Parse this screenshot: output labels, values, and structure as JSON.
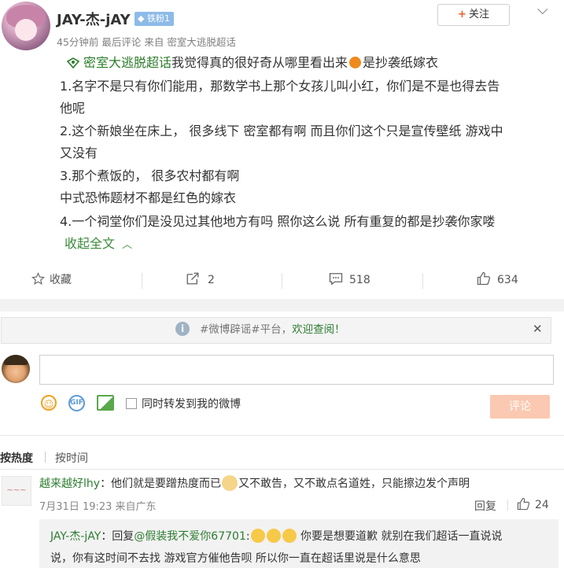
{
  "post": {
    "author": "JAY-杰-jAY",
    "badge": "铁粉1",
    "meta_time": "45分钟前",
    "meta_comment": "最后评论",
    "meta_from": "来自",
    "meta_source": "密室大逃脱超话",
    "follow_label": "关注",
    "topic": "密室大逃脱超话",
    "line0_rest_a": "我觉得真的很好奇从哪里看出来",
    "line0_rest_b": "是抄袭纸嫁衣",
    "lines": [
      "1.名字不是只有你们能用，那数学书上那个女孩儿叫小红，你们是不是也得去告",
      "他呢",
      "2.这个新娘坐在床上，  很多线下 密室都有啊 而且你们这个只是宣传壁纸 游戏中",
      "又没有",
      "3.那个煮饭的，  很多农村都有啊",
      "中式恐怖题材不都是红色的嫁衣",
      "4.一个祠堂你们是没见过其他地方有吗 照你这么说 所有重复的都是抄袭你家喽"
    ],
    "collapse_label": "收起全文"
  },
  "actions": {
    "favorite_label": "收藏",
    "repost_count": "2",
    "comment_count": "518",
    "like_count": "634"
  },
  "notice": {
    "prefix": "#微博辟谣#平台，",
    "highlight": "欢迎查阅！"
  },
  "compose": {
    "placeholder": "",
    "repost_label": "同时转发到我的微博",
    "submit_label": "评论"
  },
  "sort": {
    "hot": "按热度",
    "time": "按时间"
  },
  "comment": {
    "name": "越来越好lhy",
    "text_a": "：他们就是要蹭热度而已",
    "text_b": "又不敢告，又不敢点名道姓，只能擦边发个声明",
    "date": "7月31日 19:23 来自广东",
    "reply_label": "回复",
    "like_count": "24",
    "avatar_text": "~~~"
  },
  "reply": {
    "name": "JAY-杰-jAY",
    "reply_word": "：回复",
    "mention": "@假装我不爱你67701",
    "text_a": "你要是想要道歉 就别在我们超话一直说说",
    "text_b": "说，你有这时间不去找 游戏官方催他告呗 所以你一直在超话里说是什么意思"
  },
  "colors": {
    "topic_green": "#2b7d2b",
    "submit_disabled": "#fbc8b1",
    "follow_plus": "#f05a28"
  }
}
